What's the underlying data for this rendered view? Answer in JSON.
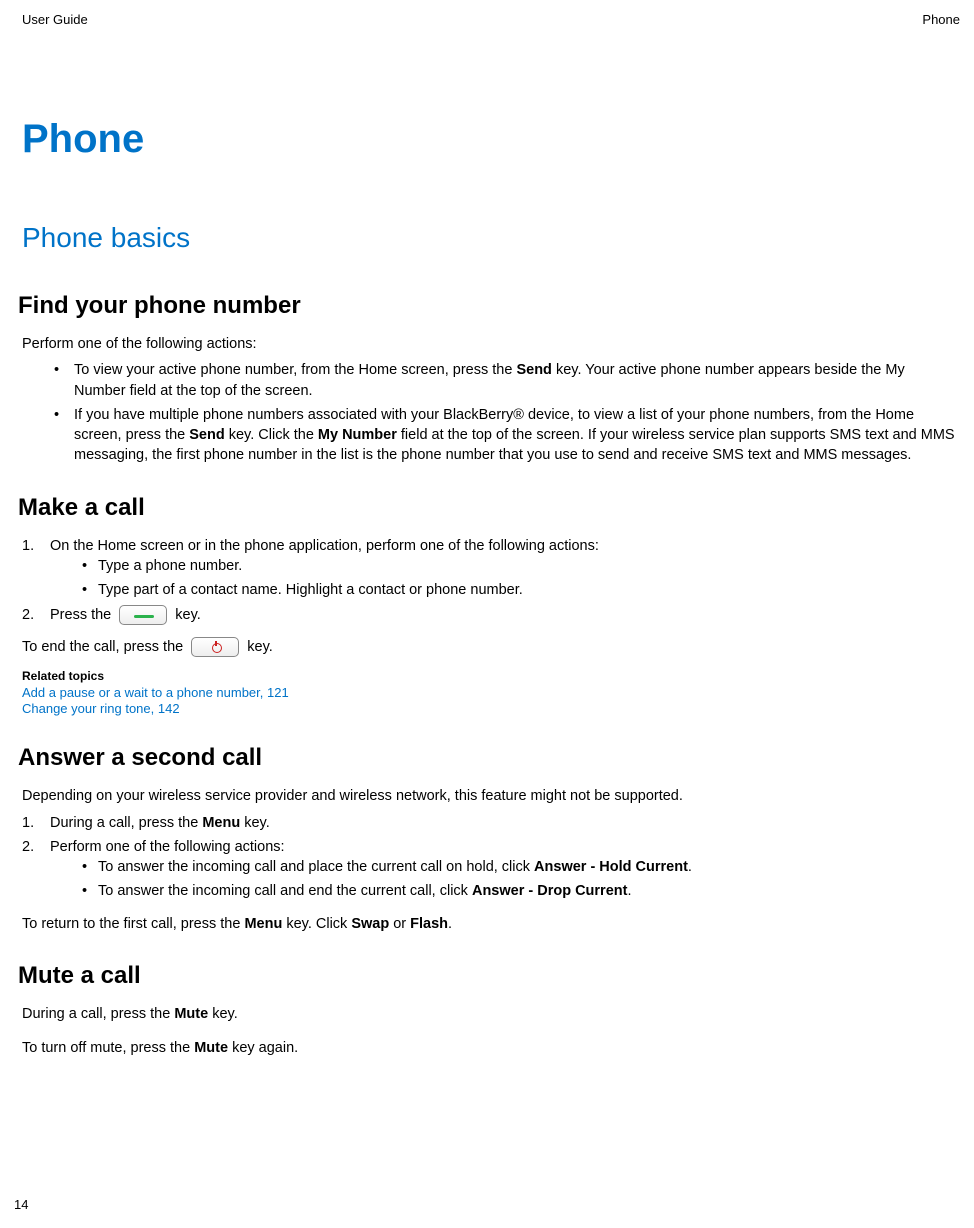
{
  "header": {
    "left": "User Guide",
    "right": "Phone"
  },
  "page_title": "Phone",
  "section_title": "Phone basics",
  "find_number": {
    "heading": "Find your phone number",
    "intro": "Perform one of the following actions:",
    "b1_pre": "To view your active phone number, from the Home screen, press the ",
    "b1_bold1": "Send",
    "b1_post": " key. Your active phone number appears beside the My Number field at the top of the screen.",
    "b2_pre": "If you have multiple phone numbers associated with your BlackBerry® device, to view a list of your phone numbers, from the Home screen, press the ",
    "b2_bold1": "Send",
    "b2_mid1": " key. Click the ",
    "b2_bold2": "My Number",
    "b2_post": " field at the top of the screen. If your wireless service plan supports SMS text and MMS messaging, the first phone number in the list is the phone number that you use to send and receive SMS text and MMS messages."
  },
  "make_call": {
    "heading": "Make a call",
    "step1": "On the Home screen or in the phone application, perform one of the following actions:",
    "s1a": "Type a phone number.",
    "s1b": "Type part of a contact name. Highlight a contact or phone number.",
    "step2_pre": "Press the ",
    "step2_post": " key.",
    "end_pre": "To end the call, press the ",
    "end_post": " key.",
    "related_label": "Related topics",
    "link1": "Add a pause or a wait to a phone number, 121",
    "link2": "Change your ring tone, 142"
  },
  "answer": {
    "heading": "Answer a second call",
    "intro": "Depending on your wireless service provider and wireless network, this feature might not be supported.",
    "step1_pre": "During a call, press the ",
    "step1_bold": "Menu",
    "step1_post": " key.",
    "step2": "Perform one of the following actions:",
    "b1_pre": "To answer the incoming call and place the current call on hold, click ",
    "b1_bold": "Answer - Hold Current",
    "b1_post": ".",
    "b2_pre": "To answer the incoming call and end the current call, click ",
    "b2_bold": "Answer - Drop Current",
    "b2_post": ".",
    "return_pre": "To return to the first call, press the ",
    "return_bold1": "Menu",
    "return_mid": " key. Click ",
    "return_bold2": "Swap",
    "return_or": " or ",
    "return_bold3": "Flash",
    "return_post": "."
  },
  "mute": {
    "heading": "Mute a call",
    "p1_pre": "During a call, press the ",
    "p1_bold": "Mute",
    "p1_post": " key.",
    "p2_pre": "To turn off mute, press the ",
    "p2_bold": "Mute",
    "p2_post": " key again."
  },
  "page_number": "14"
}
